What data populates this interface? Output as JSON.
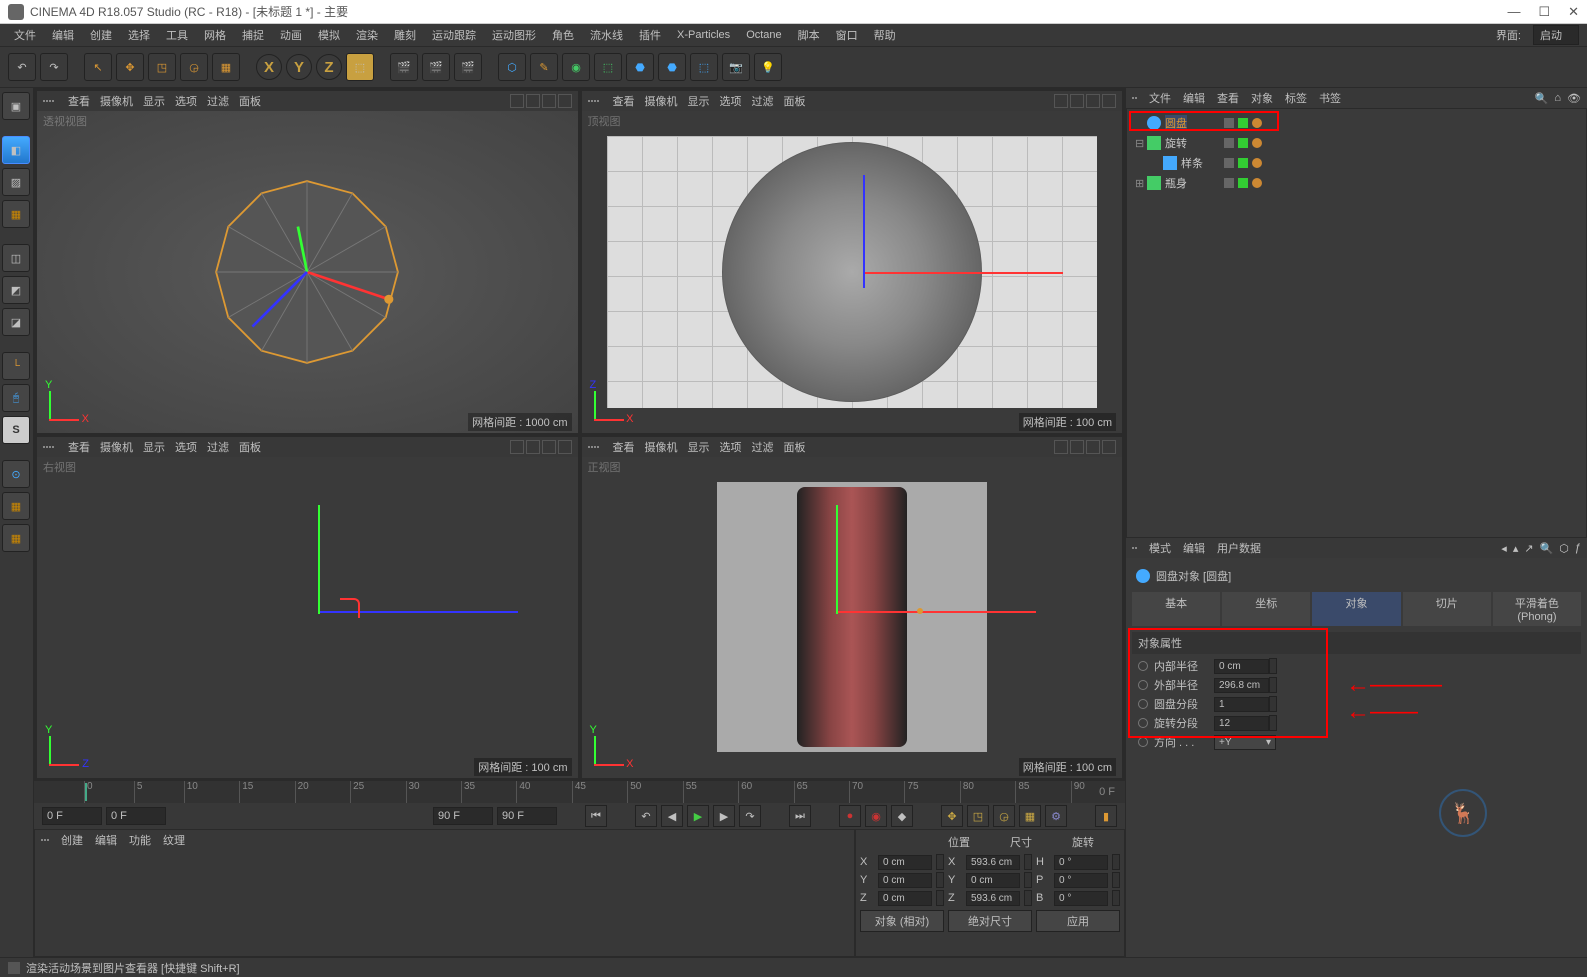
{
  "titlebar": {
    "title": "CINEMA 4D R18.057 Studio (RC - R18) - [未标题 1 *] - 主要"
  },
  "winbtns": {
    "min": "—",
    "max": "☐",
    "close": "✕"
  },
  "menubar": [
    "文件",
    "编辑",
    "创建",
    "选择",
    "工具",
    "网格",
    "捕捉",
    "动画",
    "模拟",
    "渲染",
    "雕刻",
    "运动跟踪",
    "运动图形",
    "角色",
    "流水线",
    "插件",
    "X-Particles",
    "Octane",
    "脚本",
    "窗口",
    "帮助"
  ],
  "interface": {
    "label": "界面:",
    "value": "启动"
  },
  "viewport_menu": [
    "查看",
    "摄像机",
    "显示",
    "选项",
    "过滤",
    "面板"
  ],
  "viewports": {
    "tl": {
      "label": "透视视图",
      "status": "网格间距 : 1000 cm"
    },
    "tr": {
      "label": "顶视图",
      "status": "网格间距 : 100 cm"
    },
    "bl": {
      "label": "右视图",
      "status": "网格间距 : 100 cm",
      "gizmo_y": "Y",
      "gizmo_x": "Z"
    },
    "br": {
      "label": "正视图",
      "status": "网格间距 : 100 cm",
      "gizmo_y": "Y",
      "gizmo_x": "X"
    }
  },
  "timeline": {
    "start_lbl": "0",
    "end_lbl": "0 F",
    "frame_start": "0 F",
    "frame_cur": "0 F",
    "frame_end": "90 F",
    "frame_max": "90 F",
    "ticks": [
      "0",
      "5",
      "10",
      "15",
      "20",
      "25",
      "30",
      "35",
      "40",
      "45",
      "50",
      "55",
      "60",
      "65",
      "70",
      "75",
      "80",
      "85",
      "90"
    ]
  },
  "bottom_left_menu": [
    "创建",
    "编辑",
    "功能",
    "纹理"
  ],
  "coords": {
    "hdr": [
      "位置",
      "尺寸",
      "旋转"
    ],
    "rows": [
      {
        "lbl": "X",
        "pos": "0 cm",
        "size": "593.6 cm",
        "rot": "0 °",
        "slbl": "X",
        "rlbl": "H"
      },
      {
        "lbl": "Y",
        "pos": "0 cm",
        "size": "0 cm",
        "rot": "0 °",
        "slbl": "Y",
        "rlbl": "P"
      },
      {
        "lbl": "Z",
        "pos": "0 cm",
        "size": "593.6 cm",
        "rot": "0 °",
        "slbl": "Z",
        "rlbl": "B"
      }
    ],
    "btn1": "对象 (相对)",
    "btn2": "绝对尺寸",
    "btn3": "应用"
  },
  "obj_mgr": {
    "menu": [
      "文件",
      "编辑",
      "查看",
      "对象",
      "标签",
      "书签"
    ],
    "items": [
      {
        "name": "圆盘",
        "sel": true,
        "icon": "disc",
        "indent": 0,
        "orange": true,
        "exp": ""
      },
      {
        "name": "旋转",
        "sel": false,
        "icon": "lathe",
        "indent": 0,
        "orange": false,
        "exp": "⊟"
      },
      {
        "name": "样条",
        "sel": false,
        "icon": "spline",
        "indent": 1,
        "orange": false,
        "exp": ""
      },
      {
        "name": "瓶身",
        "sel": false,
        "icon": "lathe",
        "indent": 0,
        "orange": false,
        "exp": "⊞"
      }
    ]
  },
  "attr_mgr": {
    "menu": [
      "模式",
      "编辑",
      "用户数据"
    ],
    "title": "圆盘对象 [圆盘]",
    "tabs": [
      "基本",
      "坐标",
      "对象",
      "切片",
      "平滑着色(Phong)"
    ],
    "active_tab": 2,
    "section": "对象属性",
    "props": [
      {
        "lbl": "内部半径",
        "val": "0 cm",
        "type": "num"
      },
      {
        "lbl": "外部半径",
        "val": "296.8 cm",
        "type": "num"
      },
      {
        "lbl": "圆盘分段",
        "val": "1",
        "type": "num"
      },
      {
        "lbl": "旋转分段",
        "val": "12",
        "type": "num"
      },
      {
        "lbl": "方向 . . .",
        "val": "+Y",
        "type": "combo"
      }
    ]
  },
  "statusbar": "渲染活动场景到图片查看器 [快捷键 Shift+R]"
}
